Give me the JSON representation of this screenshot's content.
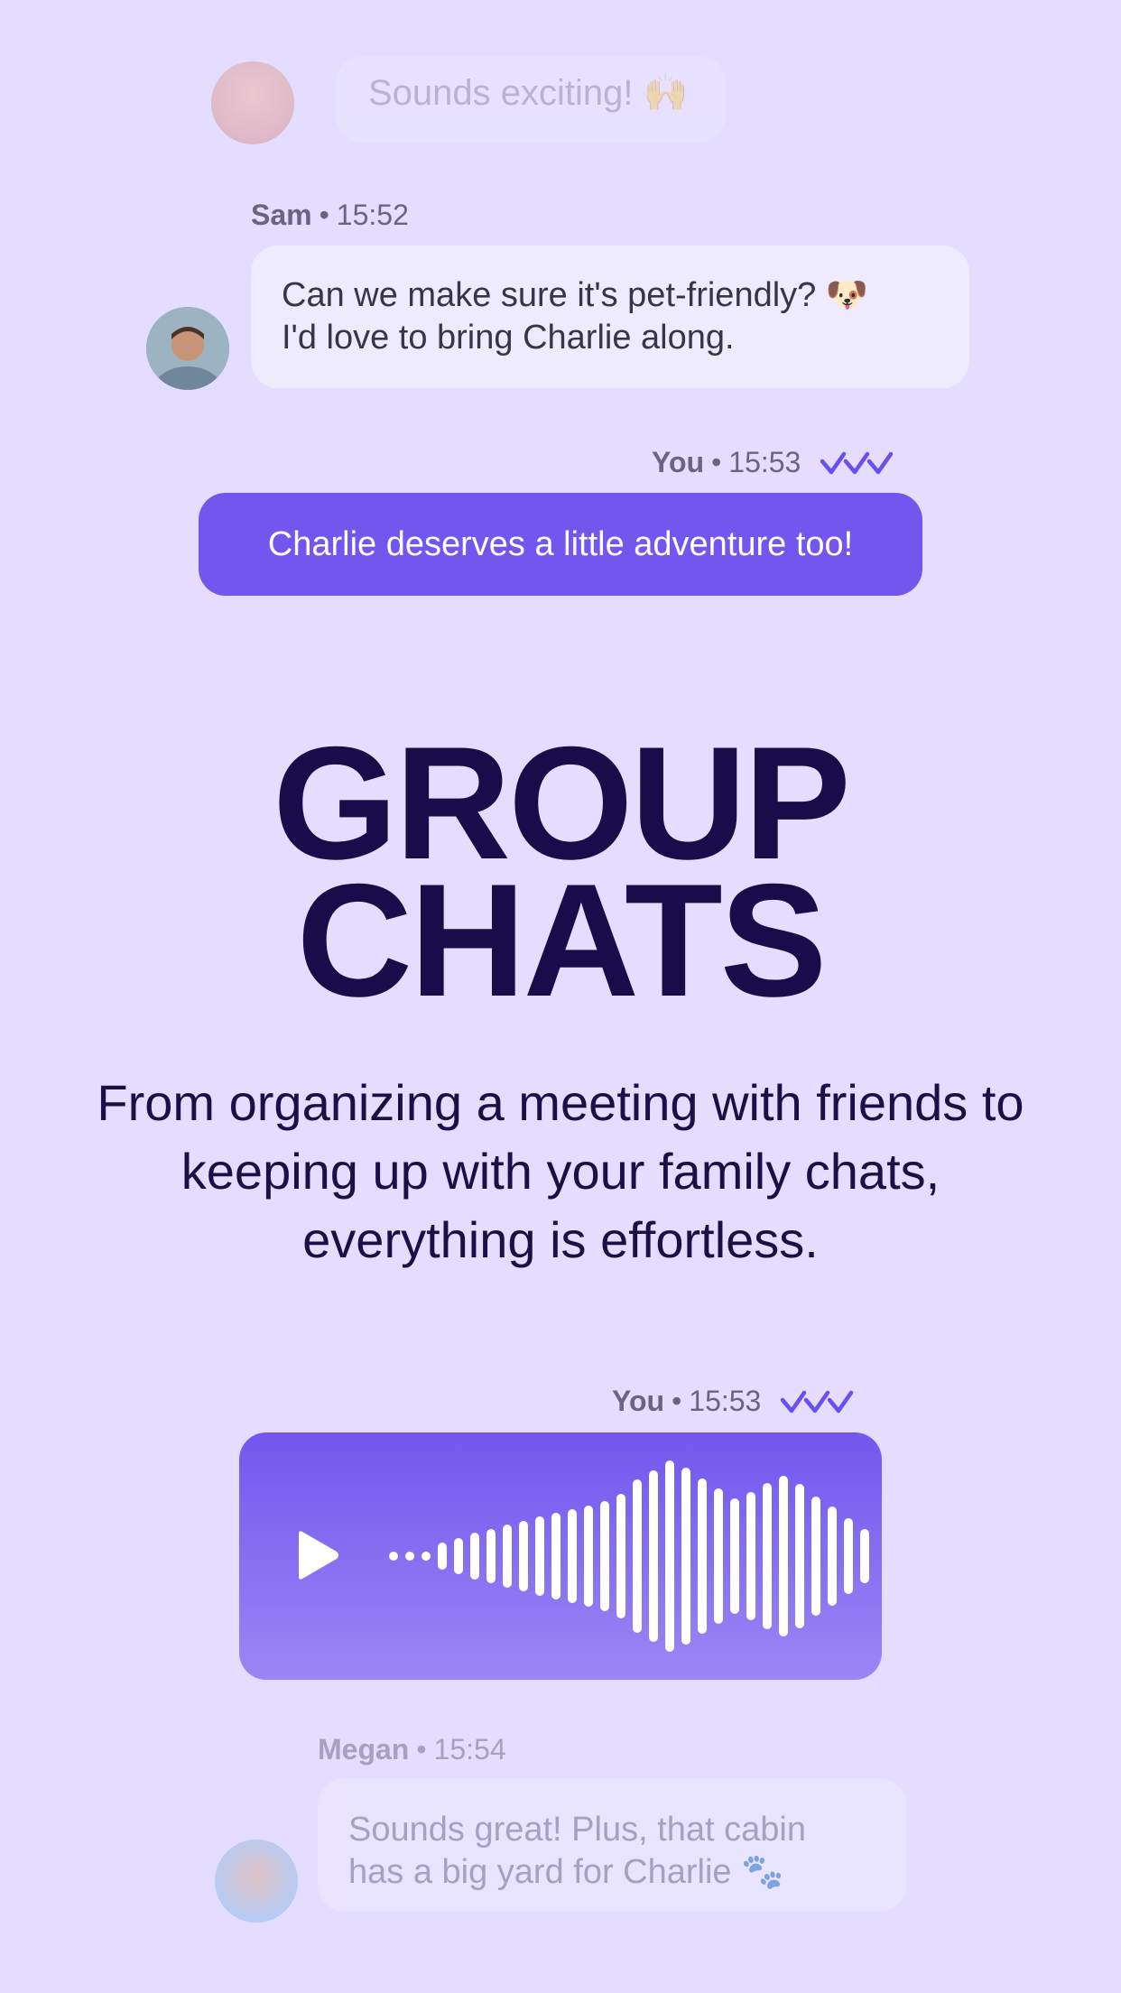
{
  "messages": {
    "top": {
      "text": "Sounds exciting! 🙌"
    },
    "sam": {
      "sender": "Sam",
      "time": "15:52",
      "line1": "Can we make sure it's pet-friendly? 🐶",
      "line2": "I'd love to bring Charlie along."
    },
    "you1": {
      "sender": "You",
      "time": "15:53",
      "text": "Charlie deserves a little adventure too!"
    },
    "you2": {
      "sender": "You",
      "time": "15:53"
    },
    "megan": {
      "sender": "Megan",
      "time": "15:54",
      "line1": "Sounds great! Plus, that cabin",
      "line2": "has a big yard for Charlie 🐾"
    }
  },
  "hero": {
    "title_line1": "GROUP",
    "title_line2": "CHATS",
    "subtitle": "From organizing a meeting with friends to keeping up with your family chats, everything is effortless."
  },
  "dot": "•",
  "colors": {
    "background": "#e4ddff",
    "accent": "#7257ee",
    "title": "#1a0c4a"
  },
  "icons": [
    "play-icon",
    "read-receipt-icon"
  ]
}
